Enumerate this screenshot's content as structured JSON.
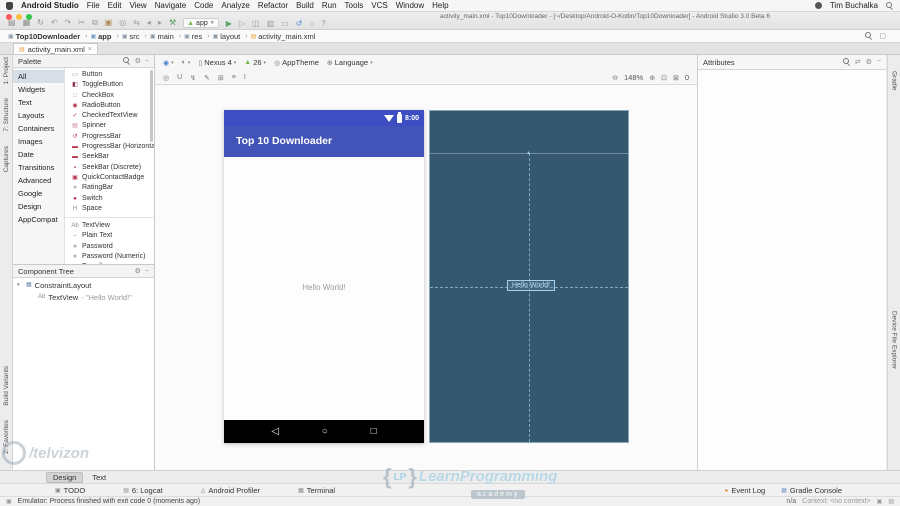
{
  "menu_bar": {
    "app_menu": "Android Studio",
    "items": [
      "File",
      "Edit",
      "View",
      "Navigate",
      "Code",
      "Analyze",
      "Refactor",
      "Build",
      "Run",
      "Tools",
      "VCS",
      "Window",
      "Help"
    ],
    "user": "Tim Buchalka"
  },
  "window": {
    "title": "activity_main.xml - Top10Downloader - [~/Desktop/Android-O-Kotlin/Top10Downloader] - Android Studio 3.0 Beta 6",
    "run_config": "app",
    "toolbar_icons_left": [
      {
        "name": "open-icon",
        "glyph": "▤",
        "color": "#8c8c8c"
      },
      {
        "name": "save-icon",
        "glyph": "▦",
        "color": "#8c8c8c"
      },
      {
        "name": "sync-icon",
        "glyph": "↻",
        "color": "#8c8c8c"
      },
      {
        "name": "undo-icon",
        "glyph": "↶",
        "color": "#9a9a9a"
      },
      {
        "name": "redo-icon",
        "glyph": "↷",
        "color": "#9a9a9a"
      },
      {
        "name": "cut-icon",
        "glyph": "✂",
        "color": "#9a9a9a"
      },
      {
        "name": "copy-icon",
        "glyph": "⧉",
        "color": "#9a9a9a"
      },
      {
        "name": "paste-icon",
        "glyph": "▣",
        "color": "#b08d57"
      },
      {
        "name": "search-icon",
        "glyph": "◎",
        "color": "#9a9a9a"
      },
      {
        "name": "replace-icon",
        "glyph": "⇆",
        "color": "#9a9a9a"
      },
      {
        "name": "back-icon",
        "glyph": "◂",
        "color": "#9a9a9a"
      },
      {
        "name": "forward-icon",
        "glyph": "▸",
        "color": "#9a9a9a"
      },
      {
        "name": "build-icon",
        "glyph": "⚒",
        "color": "#57965c"
      }
    ],
    "toolbar_icons_right": [
      {
        "name": "run-icon",
        "glyph": "▶",
        "color": "#59a869"
      },
      {
        "name": "debug-icon",
        "glyph": "▷",
        "color": "#9a9a9a"
      },
      {
        "name": "coverage-icon",
        "glyph": "◫",
        "color": "#9a9a9a"
      },
      {
        "name": "profiler-icon",
        "glyph": "▥",
        "color": "#9a9a9a"
      },
      {
        "name": "avd-manager-icon",
        "glyph": "▭",
        "color": "#9a9a9a"
      },
      {
        "name": "sync-gradle-icon",
        "glyph": "↺",
        "color": "#4a7fd6"
      },
      {
        "name": "sdk-manager-icon",
        "glyph": "⌂",
        "color": "#9a9a9a"
      },
      {
        "name": "help-icon",
        "glyph": "?",
        "color": "#9a9a9a"
      }
    ]
  },
  "breadcrumb": {
    "items": [
      {
        "label": "Top10Downloader",
        "bold": true,
        "icon_glyph": "▣",
        "icon_color": "#8d9aa8",
        "sep": "›"
      },
      {
        "label": "app",
        "bold": true,
        "icon_glyph": "▣",
        "icon_color": "#7aa0c8",
        "sep": "›"
      },
      {
        "label": "src",
        "icon_glyph": "▣",
        "icon_color": "#8d9aa8",
        "sep": "›"
      },
      {
        "label": "main",
        "icon_glyph": "▣",
        "icon_color": "#8d9aa8",
        "sep": "›"
      },
      {
        "label": "res",
        "icon_glyph": "▣",
        "icon_color": "#8d9aa8",
        "sep": "›"
      },
      {
        "label": "layout",
        "icon_glyph": "▣",
        "icon_color": "#8d9aa8",
        "sep": "›"
      },
      {
        "label": "activity_main.xml",
        "icon_glyph": "▤",
        "icon_color": "#e8a33d",
        "sep": ""
      }
    ]
  },
  "editor_tab": {
    "label": "activity_main.xml",
    "icon": "▤",
    "close_glyph": "×"
  },
  "left_strip": {
    "top": [
      {
        "label": "1: Project"
      },
      {
        "label": "7: Structure"
      },
      {
        "label": "Captures"
      }
    ],
    "bottom": [
      {
        "label": "Build Variants"
      },
      {
        "label": "2: Favorites"
      }
    ]
  },
  "right_strip": {
    "top": [
      {
        "label": "Gradle"
      }
    ],
    "mid": [
      {
        "label": "Device File Explorer"
      }
    ]
  },
  "palette": {
    "title": "Palette",
    "categories": [
      {
        "label": "All",
        "selected": true
      },
      {
        "label": "Widgets"
      },
      {
        "label": "Text"
      },
      {
        "label": "Layouts"
      },
      {
        "label": "Containers"
      },
      {
        "label": "Images"
      },
      {
        "label": "Date"
      },
      {
        "label": "Transitions"
      },
      {
        "label": "Advanced"
      },
      {
        "label": "Google"
      },
      {
        "label": "Design"
      },
      {
        "label": "AppCompat"
      }
    ],
    "widget_items": [
      {
        "label": "Button",
        "glyph": "▭",
        "color": "#8a8a8a"
      },
      {
        "label": "ToggleButton",
        "glyph": "◧",
        "color": "#8a2b4a"
      },
      {
        "label": "CheckBox",
        "glyph": "□",
        "color": "#9a9a9a"
      },
      {
        "label": "RadioButton",
        "glyph": "◉",
        "color": "#b5314a"
      },
      {
        "label": "CheckedTextView",
        "glyph": "✓",
        "color": "#b5314a"
      },
      {
        "label": "Spinner",
        "glyph": "▤",
        "color": "#c97b8e"
      },
      {
        "label": "ProgressBar",
        "glyph": "↺",
        "color": "#b5314a"
      },
      {
        "label": "ProgressBar (Horizontal)",
        "glyph": "▬",
        "color": "#b5314a"
      },
      {
        "label": "SeekBar",
        "glyph": "▬",
        "color": "#b5314a"
      },
      {
        "label": "SeekBar (Discrete)",
        "glyph": "▪",
        "color": "#b5314a"
      },
      {
        "label": "QuickContactBadge",
        "glyph": "▣",
        "color": "#b5314a"
      },
      {
        "label": "RatingBar",
        "glyph": "∗",
        "color": "#9a9a9a"
      },
      {
        "label": "Switch",
        "glyph": "●",
        "color": "#b5314a"
      },
      {
        "label": "Space",
        "glyph": "H",
        "color": "#8a8a8a"
      }
    ],
    "text_items": [
      {
        "label": "TextView",
        "glyph": "Ab",
        "color": "#8a8a8a"
      },
      {
        "label": "Plain Text",
        "glyph": "–",
        "color": "#8a8a8a"
      },
      {
        "label": "Password",
        "glyph": "∗",
        "color": "#8a8a8a"
      },
      {
        "label": "Password (Numeric)",
        "glyph": "∗",
        "color": "#8a8a8a"
      },
      {
        "label": "E-mail",
        "glyph": "@",
        "color": "#8a8a8a"
      }
    ]
  },
  "component_tree": {
    "title": "Component Tree",
    "nodes": [
      {
        "expander": "▾",
        "icon_glyph": "▦",
        "icon_color": "#6f8fb0",
        "label": "ConstraintLayout",
        "detail": "",
        "indent": 0
      },
      {
        "expander": "",
        "icon_glyph": "Ab",
        "icon_color": "#8a8a8a",
        "label": "TextView",
        "detail": "- \"Hello World!\"",
        "indent": 1
      }
    ]
  },
  "design_toolbar": {
    "surface_icon": "◉",
    "orientation_icon": "◐",
    "device": "Nexus 4",
    "api": "26",
    "theme": "AppTheme",
    "language": "Language",
    "caret": "▾",
    "row2_icons": [
      {
        "name": "show-constraints-icon",
        "glyph": "◎"
      },
      {
        "name": "autoconnect-icon",
        "glyph": "U"
      },
      {
        "name": "clear-constraints-icon",
        "glyph": "↯"
      },
      {
        "name": "infer-constraints-icon",
        "glyph": "✎"
      },
      {
        "name": "guidelines-icon",
        "glyph": "⊞"
      },
      {
        "name": "align-icon",
        "glyph": "≡"
      },
      {
        "name": "pack-icon",
        "glyph": "I"
      }
    ],
    "zoom_out": "⊖",
    "zoom_level": "148%",
    "zoom_in": "⊕",
    "zoom_fit": "⊡",
    "pan_icon": "⊠",
    "error_count": "0"
  },
  "attributes_panel": {
    "title": "Attributes",
    "icons": [
      "⇄",
      "⚙",
      "−"
    ]
  },
  "preview": {
    "status_time": "8:00",
    "app_title": "Top 10 Downloader",
    "hello_design": "Hello World!",
    "hello_blueprint": "Hello World!",
    "nav_back": "◁",
    "nav_home": "○",
    "nav_recents": "□",
    "bp_anchor": "▲"
  },
  "bottom_tabs": {
    "tabs": [
      {
        "label": "Design",
        "selected": true
      },
      {
        "label": "Text"
      }
    ]
  },
  "tool_windows": {
    "left": [
      {
        "label": "TODO",
        "glyph": "▣",
        "color": "#8a8a8a"
      },
      {
        "label": "6: Logcat",
        "glyph": "▤",
        "color": "#8a8a8a"
      },
      {
        "label": "Android Profiler",
        "glyph": "◬",
        "color": "#8a8a8a"
      },
      {
        "label": "Terminal",
        "glyph": "▦",
        "color": "#8a8a8a"
      }
    ],
    "right": [
      {
        "label": "Event Log",
        "glyph": "▸",
        "color": "#d9822b"
      },
      {
        "label": "Gradle Console",
        "glyph": "▦",
        "color": "#7aa0c8"
      }
    ]
  },
  "status_bar": {
    "message": "Emulator: Process finished with exit code 0 (moments ago)",
    "na": "n/a",
    "context": "Context: <no context>"
  },
  "watermarks": {
    "corner": "/telvizon",
    "lp_left_brace": "{",
    "lp": "LP",
    "lp_right_brace": "}",
    "main": "LearnProgramming",
    "badge": "academy"
  },
  "colors": {
    "app_bar": "#4254B7",
    "status_bar_phone": "#3D4EC2",
    "blueprint_bg": "#35586E",
    "blueprint_line": "#9CC3DD",
    "selection_border": "#A5CFEA",
    "nav_bar": "#000000"
  }
}
